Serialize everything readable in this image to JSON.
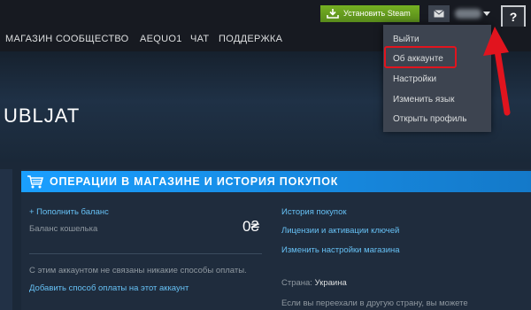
{
  "topbar": {
    "install_label": "Установить Steam",
    "help_label": "?"
  },
  "nav": {
    "items": [
      "МАГАЗИН",
      "СООБЩЕСТВО",
      "AEQUO1",
      "ЧАТ",
      "ПОДДЕРЖКА"
    ]
  },
  "dropdown": {
    "items": [
      "Выйти",
      "Об аккаунте",
      "Настройки",
      "Изменить язык",
      "Открыть профиль"
    ],
    "highlighted_index": 1
  },
  "hero": {
    "title": "UBLJAT"
  },
  "section": {
    "title": "ОПЕРАЦИИ В МАГАЗИНЕ И ИСТОРИЯ ПОКУПОК",
    "add_funds": "+ Пополнить баланс",
    "wallet_label": "Баланс кошелька",
    "wallet_value": "0₴",
    "no_payment": "С этим аккаунтом не связаны никакие способы оплаты.",
    "add_payment": "Добавить способ оплаты на этот аккаунт",
    "links": [
      "История покупок",
      "Лицензии и активации ключей",
      "Изменить настройки магазина"
    ],
    "country_label": "Страна:",
    "country_value": "Украина",
    "moved_text": "Если вы переехали в другую страну, вы можете"
  },
  "colors": {
    "accent": "#1a9fff",
    "link": "#66c0f4",
    "highlight": "#e1141e",
    "install": "#75b022"
  }
}
